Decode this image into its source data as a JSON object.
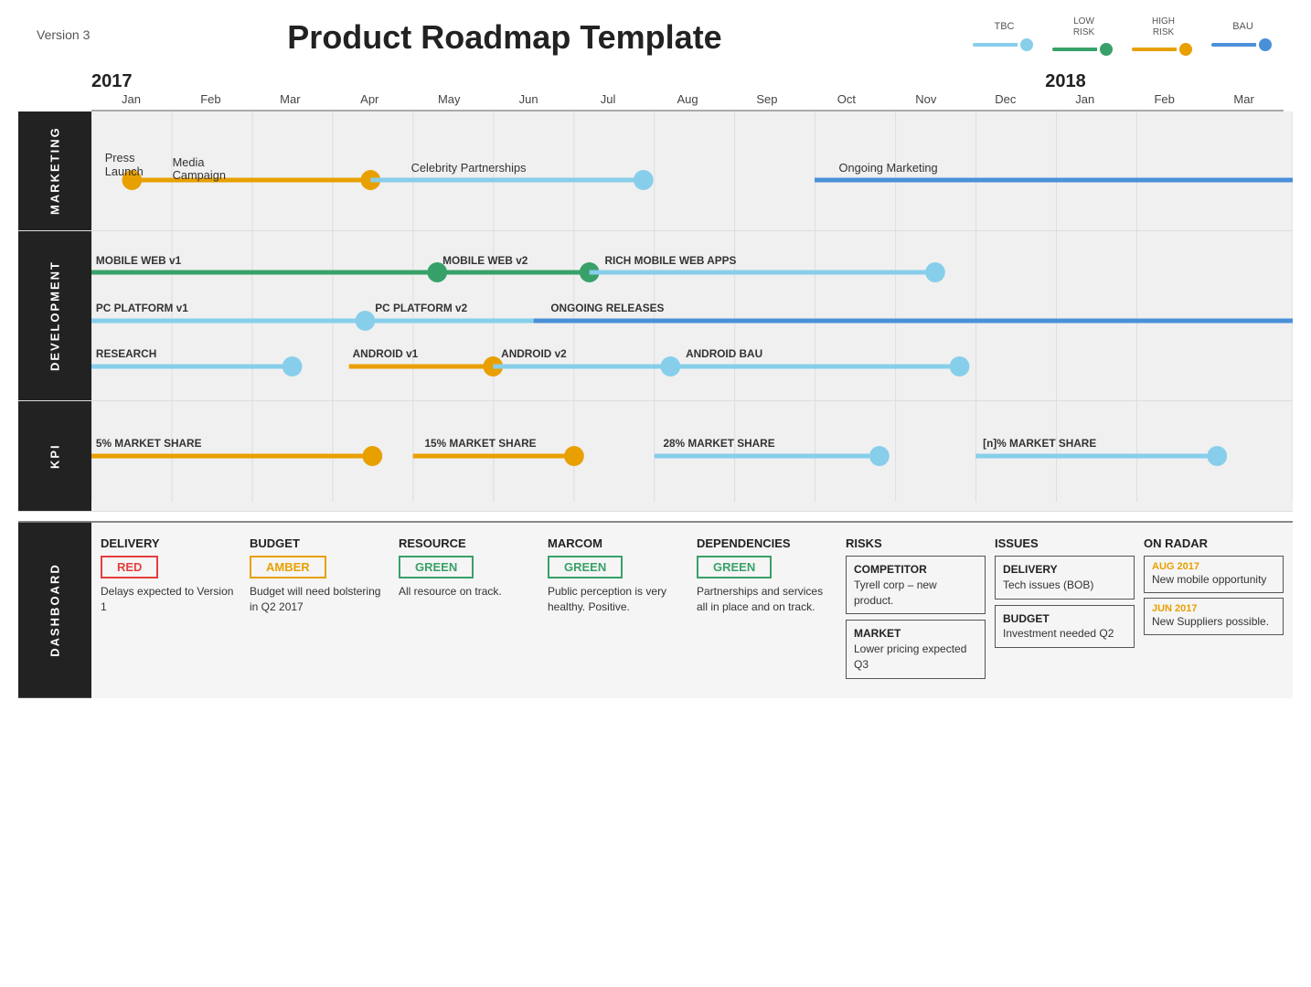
{
  "header": {
    "version": "Version 3",
    "title": "Product Roadmap Template",
    "legend": [
      {
        "label": "TBC",
        "color": "#87ceeb",
        "lineColor": "#87ceeb"
      },
      {
        "label_top": "LOW\nRISK",
        "label": "LOW RISK",
        "color": "#38a169",
        "lineColor": "#38a169"
      },
      {
        "label_top": "HIGH\nRISK",
        "label": "HIGH RISK",
        "color": "#e8a000",
        "lineColor": "#e8a000"
      },
      {
        "label": "BAU",
        "color": "#4a90d9",
        "lineColor": "#4a90d9"
      }
    ]
  },
  "timeline": {
    "years": [
      {
        "label": "2017",
        "months": [
          "Jan",
          "Feb",
          "Mar",
          "Apr",
          "May",
          "Jun",
          "Jul",
          "Aug",
          "Sep",
          "Oct",
          "Nov",
          "Dec"
        ]
      },
      {
        "label": "2018",
        "months": [
          "Jan",
          "Feb",
          "Mar"
        ]
      }
    ]
  },
  "sections": [
    {
      "id": "marketing",
      "label": "MARKETING",
      "tracks": [
        {
          "items": [
            {
              "type": "milestone",
              "label": "Press\nLaunch",
              "col": 0.5
            },
            {
              "type": "bar",
              "label": "Media\nCampaign",
              "start": 1,
              "end": 3.2,
              "color": "#e8a000"
            },
            {
              "type": "bar",
              "label": "Celebrity Partnerships",
              "start": 3.2,
              "end": 6.5,
              "color": "#87ceeb"
            },
            {
              "type": "bar",
              "label": "Ongoing Marketing",
              "start": 8.5,
              "end": 15,
              "color": "#4a90d9"
            }
          ]
        }
      ]
    },
    {
      "id": "development",
      "label": "DEVELOPMENT",
      "tracks": [
        {
          "items": [
            {
              "type": "bar",
              "label": "MOBILE WEB v1",
              "start": 0,
              "end": 4.3,
              "color": "#38a169"
            },
            {
              "type": "bar",
              "label": "MOBILE WEB v2",
              "start": 4.3,
              "end": 6.2,
              "color": "#38a169"
            },
            {
              "type": "bar",
              "label": "RICH MOBILE WEB APPS",
              "start": 6.2,
              "end": 10.5,
              "color": "#87ceeb"
            }
          ]
        },
        {
          "items": [
            {
              "type": "bar",
              "label": "PC PLATFORM v1",
              "start": 0,
              "end": 3.4,
              "color": "#87ceeb"
            },
            {
              "type": "bar",
              "label": "PC PLATFORM v2",
              "start": 3.4,
              "end": 5.5,
              "color": "#87ceeb"
            },
            {
              "type": "bar",
              "label": "ONGOING RELEASES",
              "start": 5.5,
              "end": 15,
              "color": "#4a90d9"
            }
          ]
        },
        {
          "items": [
            {
              "type": "bar",
              "label": "RESEARCH",
              "start": 0,
              "end": 2.5,
              "color": "#87ceeb"
            },
            {
              "type": "bar",
              "label": "ANDROID v1",
              "start": 3.2,
              "end": 5.0,
              "color": "#e8a000"
            },
            {
              "type": "bar",
              "label": "ANDROID v2",
              "start": 5.0,
              "end": 7.2,
              "color": "#87ceeb"
            },
            {
              "type": "bar",
              "label": "ANDROID BAU",
              "start": 7.2,
              "end": 10.8,
              "color": "#87ceeb"
            }
          ]
        }
      ]
    },
    {
      "id": "kpi",
      "label": "KPI",
      "tracks": [
        {
          "items": [
            {
              "type": "bar_kpi",
              "label": "5% MARKET SHARE",
              "start": 0,
              "end": 3.5,
              "color": "#e8a000"
            },
            {
              "type": "bar_kpi",
              "label": "15% MARKET SHARE",
              "start": 3.5,
              "end": 6.0,
              "color": "#e8a000"
            },
            {
              "type": "bar_kpi",
              "label": "28% MARKET SHARE",
              "start": 6.5,
              "end": 9.8,
              "color": "#87ceeb"
            },
            {
              "type": "bar_kpi",
              "label": "[n]% MARKET SHARE",
              "start": 11.0,
              "end": 14.0,
              "color": "#87ceeb"
            }
          ]
        }
      ]
    }
  ],
  "dashboard": {
    "label": "DASHBOARD",
    "columns": [
      {
        "id": "delivery",
        "title": "DELIVERY",
        "badge": "RED",
        "badge_color": "red",
        "text": "Delays expected to Version 1"
      },
      {
        "id": "budget",
        "title": "BUDGET",
        "badge": "AMBER",
        "badge_color": "amber",
        "text": "Budget will need bolstering in Q2 2017"
      },
      {
        "id": "resource",
        "title": "RESOURCE",
        "badge": "GREEN",
        "badge_color": "green",
        "text": "All resource on track."
      },
      {
        "id": "marcom",
        "title": "MARCOM",
        "badge": "GREEN",
        "badge_color": "green",
        "text": "Public perception is very healthy. Positive."
      },
      {
        "id": "dependencies",
        "title": "DEPENDENCIES",
        "badge": "GREEN",
        "badge_color": "green",
        "text": "Partnerships and services all in place and on track."
      },
      {
        "id": "risks",
        "title": "RISKS",
        "items": [
          {
            "title": "COMPETITOR",
            "text": "Tyrell corp – new product."
          },
          {
            "title": "MARKET",
            "text": "Lower pricing expected Q3"
          }
        ]
      },
      {
        "id": "issues",
        "title": "ISSUES",
        "items": [
          {
            "title": "DELIVERY",
            "text": "Tech issues (BOB)"
          },
          {
            "title": "BUDGET",
            "text": "Investment needed Q2"
          }
        ]
      },
      {
        "id": "on_radar",
        "title": "ON RADAR",
        "items": [
          {
            "date": "AUG 2017",
            "text": "New mobile opportunity"
          },
          {
            "date": "JUN 2017",
            "text": "New Suppliers possible."
          }
        ]
      }
    ]
  }
}
